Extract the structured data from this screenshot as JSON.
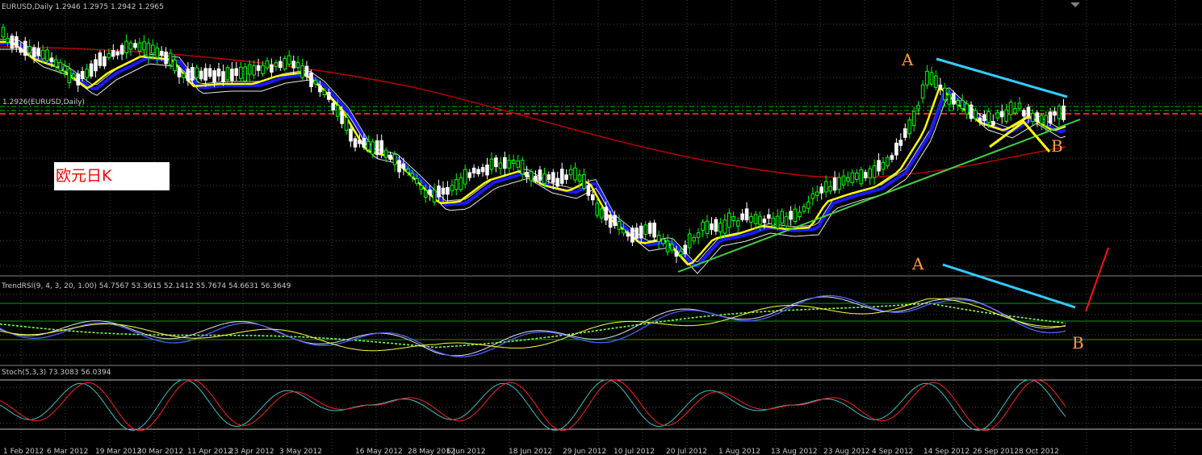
{
  "window": {
    "title": "EURUSD,Daily  1.2946 1.2975 1.2942 1.2965",
    "price_level_label": "1.2926(EURUSD,Daily)"
  },
  "rsi_panel": {
    "title": "TrendRSI(9, 4, 3, 20, 1.00) 54.7567 53.3615 52.1412 55.7674 54.6631 56.3649"
  },
  "stoch_panel": {
    "title": "Stoch(5,3,3) 73.3083 56.0394"
  },
  "annotations": {
    "label_a": "A",
    "label_b": "B",
    "note": "欧元日K"
  },
  "date_axis": [
    "1 Feb 2012",
    "6 Mar 2012",
    "19 Mar 2012",
    "30 Mar 2012",
    "11 Apr 2012",
    "23 Apr 2012",
    "3 May 2012",
    "16 May 2012",
    "28 May 2012",
    "6 Jun 2012",
    "18 Jun 2012",
    "29 Jun 2012",
    "10 Jul 2012",
    "20 Jul 2012",
    "1 Aug 2012",
    "13 Aug 2012",
    "23 Aug 2012",
    "4 Sep 2012",
    "14 Sep 2012",
    "26 Sep 2012",
    "8 Oct 2012"
  ],
  "colors": {
    "background": "#000000",
    "grid": "#3a4a3a",
    "bull_candle": "#00ff00",
    "bear_candle": "#ffffff",
    "ma_yellow": "#ffff00",
    "ma_blue": "#1a1aff",
    "ma_red": "#c00000",
    "trendline_green": "#40d040",
    "trendline_cyan": "#33ccff",
    "annotation_orange": "#ff9a3c",
    "level_red": "#ff2020",
    "level_green": "#00c000",
    "stoch_main": "#40c0c0",
    "stoch_signal": "#ff2020"
  }
}
